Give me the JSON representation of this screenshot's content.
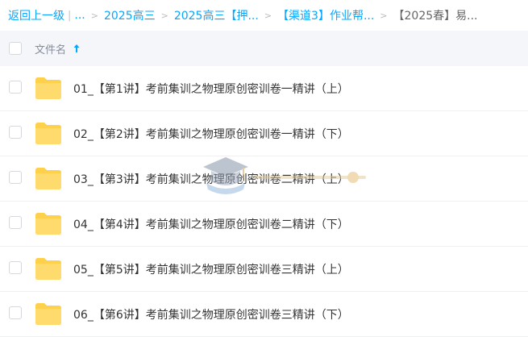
{
  "breadcrumb": {
    "back": "返回上一级",
    "ellipsis": "...",
    "items": [
      "2025高三",
      "2025高三【押...",
      "【渠道3】作业帮...",
      "【2025春】易..."
    ]
  },
  "header": {
    "column_name": "文件名"
  },
  "files": [
    {
      "name": "01_【第1讲】考前集训之物理原创密训卷一精讲（上）"
    },
    {
      "name": "02_【第2讲】考前集训之物理原创密训卷一精讲（下）"
    },
    {
      "name": "03_【第3讲】考前集训之物理原创密训卷二精讲（上）"
    },
    {
      "name": "04_【第4讲】考前集训之物理原创密训卷二精讲（下）"
    },
    {
      "name": "05_【第5讲】考前集训之物理原创密训卷三精讲（上）"
    },
    {
      "name": "06_【第6讲】考前集训之物理原创密训卷三精讲（下）"
    }
  ],
  "colors": {
    "accent": "#06a7ff",
    "folder": "#ffd04b",
    "header_bg": "#f5f6fa"
  }
}
